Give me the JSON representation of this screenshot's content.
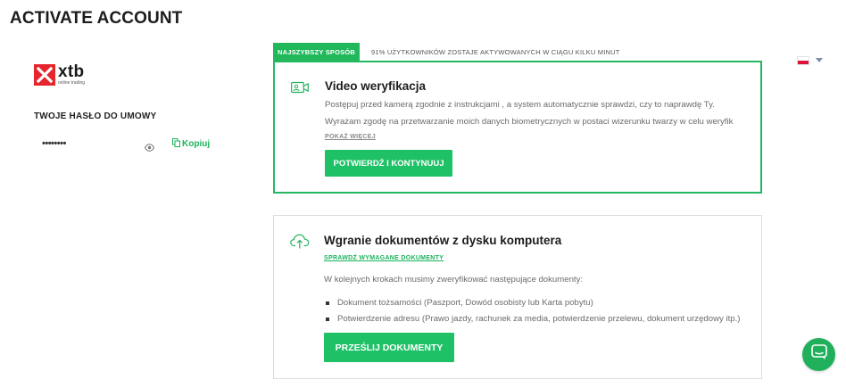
{
  "page": {
    "title": "ACTIVATE ACCOUNT"
  },
  "brand": {
    "name": "xtb",
    "tagline": "online trading",
    "color": "#e6262c"
  },
  "password_panel": {
    "label": "TWOJE HASŁO DO UMOWY",
    "masked_value": "••••••••",
    "copy_label": "Kopiuj"
  },
  "tabs": {
    "fastest_label": "NAJSZYBSZY SPOSÓB",
    "note": "91% UŻYTKOWNIKÓW ZOSTAJE AKTYWOWANYCH W CIĄGU KILKU MINUT"
  },
  "language": {
    "selected": "PL"
  },
  "video_card": {
    "title": "Video weryfikacja",
    "description": "Postępuj przed kamerą zgodnie z instrukcjami , a system automatycznie sprawdzi, czy to naprawdę Ty.",
    "consent": "Wyrażam zgodę na przetwarzanie moich danych biometrycznych w postaci wizerunku twarzy w celu weryfik",
    "show_more": "POKAŻ WIĘCEJ",
    "button_label": "POTWIERDŹ I KONTYNUUJ"
  },
  "docs_card": {
    "title": "Wgranie dokumentów z dysku komputera",
    "requirements_link": "SPRAWDŹ WYMAGANE DOKUMENTY",
    "intro": "W kolejnych krokach musimy zweryfikować następujące dokumenty:",
    "items": [
      "Dokument tożsamości (Paszport, Dowód osobisty lub Karta pobytu)",
      "Potwierdzenie adresu (Prawo jazdy, rachunek za media, potwierdzenie przelewu, dokument urzędowy itp.)"
    ],
    "button_label": "PRZEŚLIJ DOKUMENTY"
  },
  "colors": {
    "accent": "#1fc167",
    "border_active": "#26b861",
    "text_muted": "#6b6b6b"
  },
  "icons": {
    "video": "video-camera-icon",
    "upload": "cloud-upload-icon",
    "eye": "eye-icon",
    "copy": "copy-icon",
    "chat": "chat-icon"
  }
}
